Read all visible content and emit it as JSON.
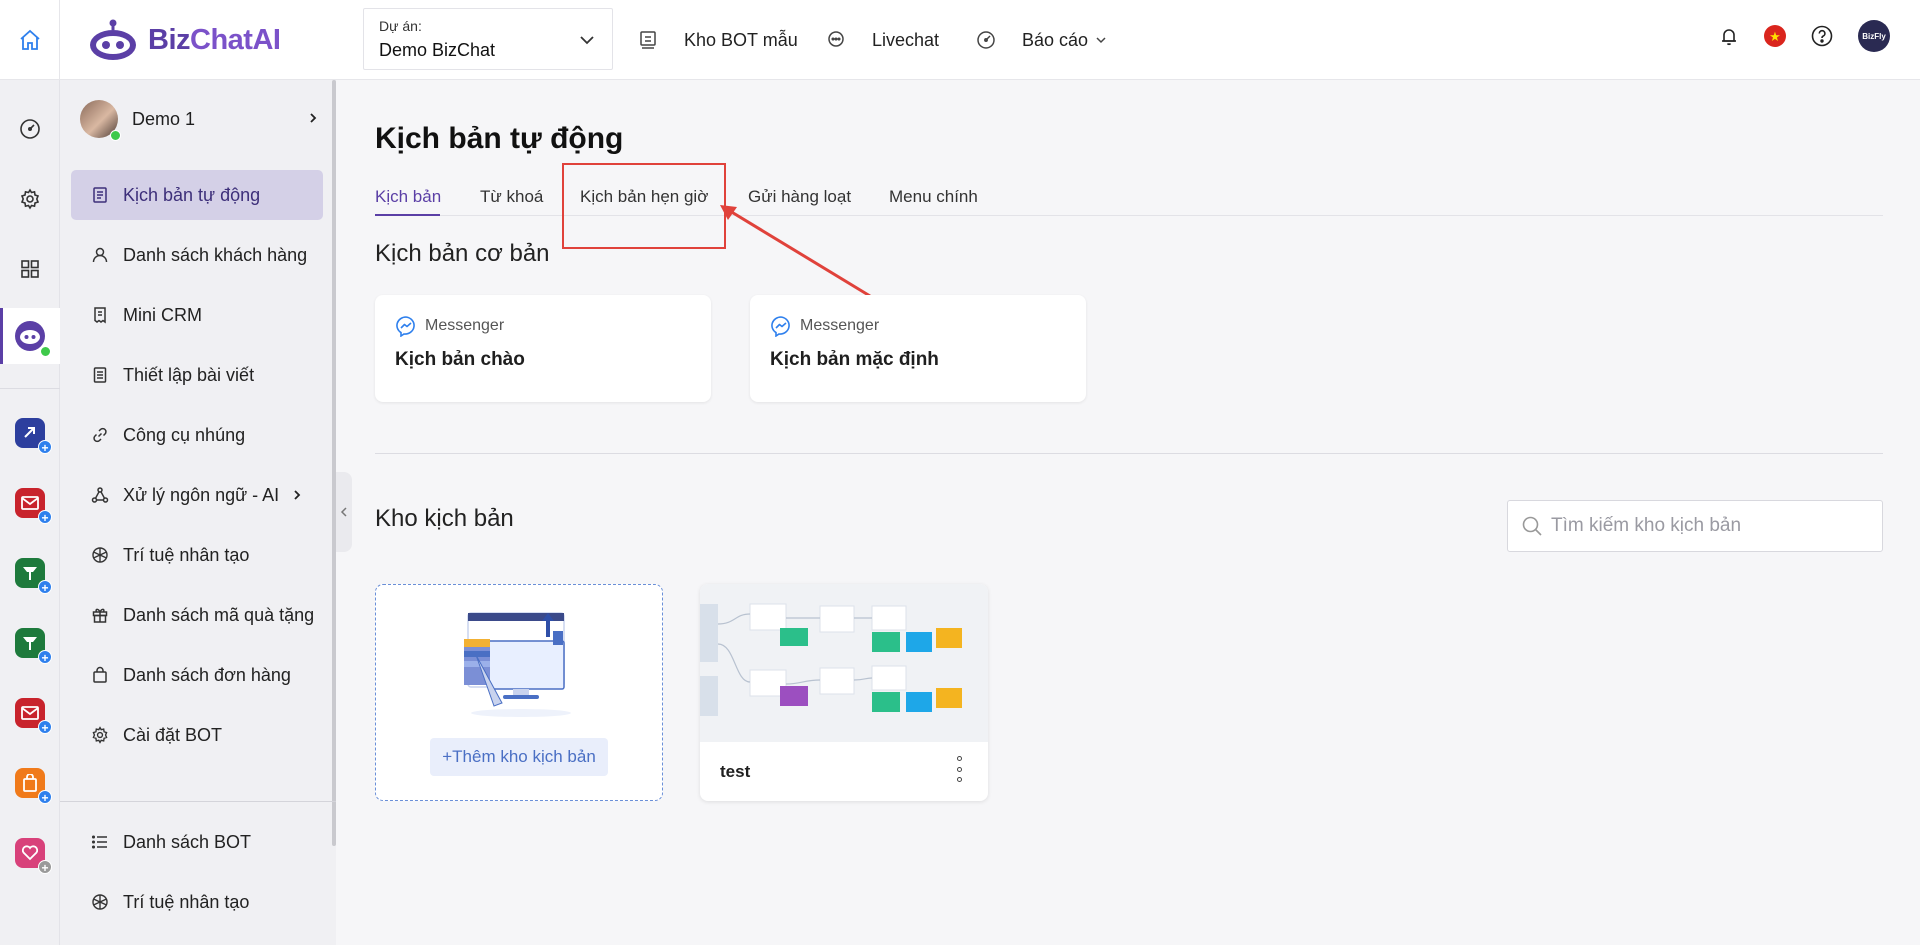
{
  "brand": {
    "name_part1": "Biz",
    "name_part2": "ChatAI"
  },
  "project": {
    "label": "Dự án:",
    "value": "Demo BizChat"
  },
  "topnav": [
    {
      "label": "Kho BOT mẫu"
    },
    {
      "label": "Livechat"
    },
    {
      "label": "Báo cáo"
    }
  ],
  "user": {
    "avatar_text": "BizFly"
  },
  "bot": {
    "name": "Demo 1"
  },
  "sidebar": {
    "items": [
      {
        "label": "Kịch bản tự động"
      },
      {
        "label": "Danh sách khách hàng"
      },
      {
        "label": "Mini CRM"
      },
      {
        "label": "Thiết lập bài viết"
      },
      {
        "label": "Công cụ nhúng"
      },
      {
        "label": "Xử lý ngôn ngữ - AI"
      },
      {
        "label": "Trí tuệ nhân tạo"
      },
      {
        "label": "Danh sách mã quà tặng"
      },
      {
        "label": "Danh sách đơn hàng"
      },
      {
        "label": "Cài đặt BOT"
      }
    ],
    "bottom_items": [
      {
        "label": "Danh sách BOT"
      },
      {
        "label": "Trí tuệ nhân tạo"
      }
    ]
  },
  "page": {
    "title": "Kịch bản tự động",
    "tabs": [
      {
        "label": "Kịch bản"
      },
      {
        "label": "Từ khoá"
      },
      {
        "label": "Kịch bản hẹn giờ"
      },
      {
        "label": "Gửi hàng loạt"
      },
      {
        "label": "Menu chính"
      }
    ],
    "basic_section_title": "Kịch bản cơ bản",
    "basic_cards": [
      {
        "channel": "Messenger",
        "title": "Kịch bản chào"
      },
      {
        "channel": "Messenger",
        "title": "Kịch bản mặc định"
      }
    ],
    "library_title": "Kho kịch bản",
    "search_placeholder": "Tìm kiếm kho kịch bản",
    "add_label": "+Thêm kho kịch bản",
    "template_name": "test"
  },
  "colors": {
    "accent": "#5b3fa6",
    "highlight": "#e0423b",
    "link": "#2f80ed"
  }
}
